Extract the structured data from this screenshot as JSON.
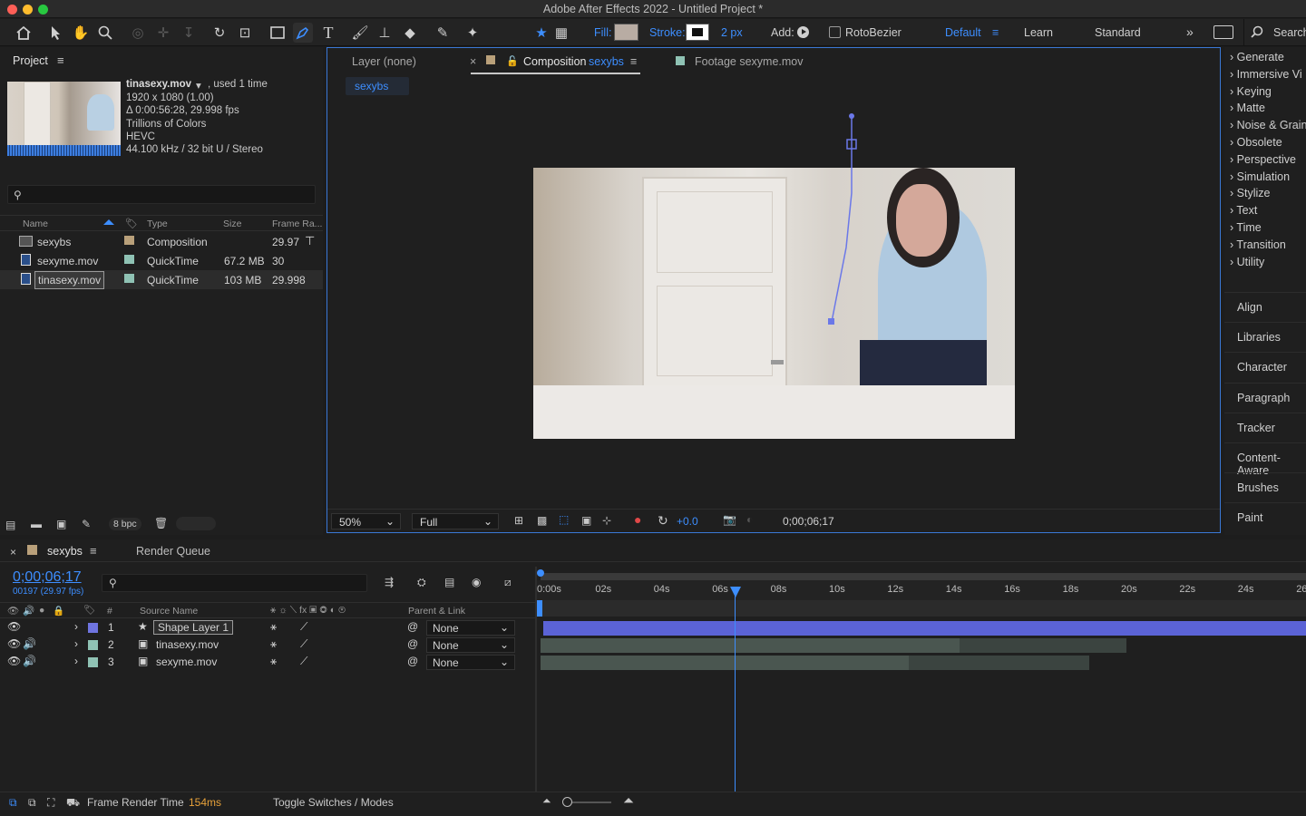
{
  "window": {
    "title": "Adobe After Effects 2022 - Untitled Project *"
  },
  "toolbar": {
    "fill_label": "Fill:",
    "stroke_label": "Stroke:",
    "stroke_width": "2 px",
    "add_label": "Add:",
    "rotobezier_label": "RotoBezier",
    "workspace_default": "Default",
    "workspace_learn": "Learn",
    "workspace_standard": "Standard",
    "search_label": "Search",
    "fill_color": "#b8aca3",
    "stroke_color": "#ffffff"
  },
  "project": {
    "title": "Project",
    "selected_name": "tinasexy.mov",
    "selected_used": ", used 1 time",
    "info": [
      "1920 x 1080 (1.00)",
      "Δ 0:00:56:28, 29.998 fps",
      "Trillions of Colors",
      "HEVC",
      "44.100 kHz / 32 bit U / Stereo"
    ],
    "columns": {
      "name": "Name",
      "type": "Type",
      "size": "Size",
      "frame_rate": "Frame Ra..."
    },
    "items": [
      {
        "name": "sexybs",
        "type": "Composition",
        "size": "",
        "fps": "29.97",
        "swatch": "#b9a07a"
      },
      {
        "name": "sexyme.mov",
        "type": "QuickTime",
        "size": "67.2 MB",
        "fps": "30",
        "swatch": "#8fc2b4"
      },
      {
        "name": "tinasexy.mov",
        "type": "QuickTime",
        "size": "103 MB",
        "fps": "29.998",
        "swatch": "#8fc2b4"
      }
    ],
    "bpc": "8 bpc"
  },
  "viewer": {
    "tab_layer": "Layer (none)",
    "tab_comp_prefix": "Composition",
    "tab_comp_name": "sexybs",
    "tab_footage": "Footage sexyme.mov",
    "breadcrumb": "sexybs",
    "zoom": "50%",
    "resolution": "Full",
    "exposure": "+0.0",
    "timecode": "0;00;06;17"
  },
  "effects": {
    "categories": [
      "Generate",
      "Immersive Vi",
      "Keying",
      "Matte",
      "Noise & Grain",
      "Obsolete",
      "Perspective",
      "Simulation",
      "Stylize",
      "Text",
      "Time",
      "Transition",
      "Utility"
    ],
    "panels": [
      "Align",
      "Libraries",
      "Character",
      "Paragraph",
      "Tracker",
      "Content-Aware",
      "Brushes",
      "Paint"
    ]
  },
  "timeline": {
    "tab_comp": "sexybs",
    "tab_render": "Render Queue",
    "timecode": "0;00;06;17",
    "frame_info": "00197 (29.97 fps)",
    "col_hash": "#",
    "col_source": "Source Name",
    "col_parent": "Parent & Link",
    "layers": [
      {
        "num": "1",
        "name": "Shape Layer 1",
        "parent": "None",
        "color": "#6f74e0"
      },
      {
        "num": "2",
        "name": "tinasexy.mov",
        "parent": "None",
        "color": "#8fc2b4"
      },
      {
        "num": "3",
        "name": "sexyme.mov",
        "parent": "None",
        "color": "#8fc2b4"
      }
    ],
    "ruler": [
      "0:00s",
      "02s",
      "04s",
      "06s",
      "08s",
      "10s",
      "12s",
      "14s",
      "16s",
      "18s",
      "20s",
      "22s",
      "24s",
      "26"
    ],
    "render_time_label": "Frame Render Time",
    "render_time_value": "154ms",
    "toggle_label": "Toggle Switches / Modes"
  }
}
